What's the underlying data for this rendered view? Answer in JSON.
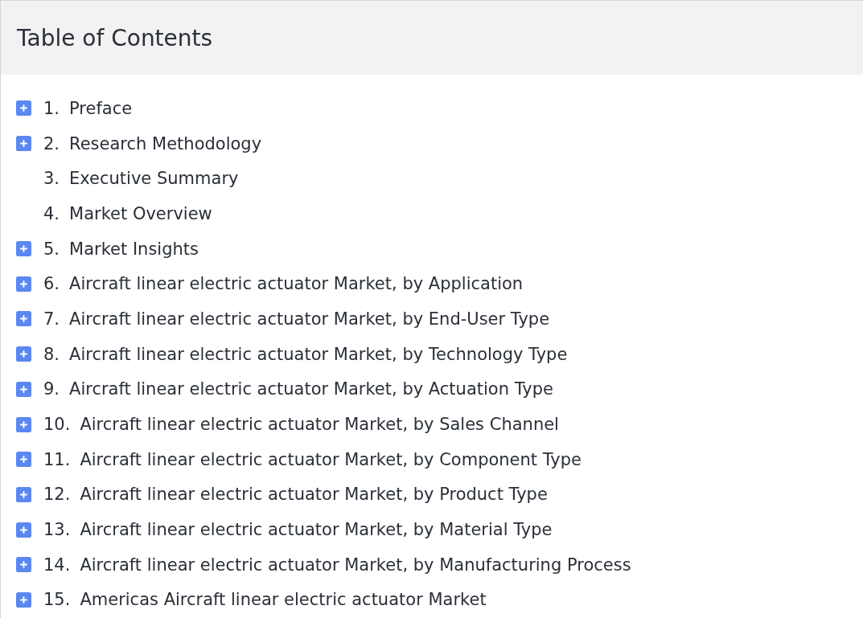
{
  "title": "Table of Contents",
  "items": [
    {
      "number": "1.",
      "label": "Preface",
      "expandable": true
    },
    {
      "number": "2.",
      "label": "Research Methodology",
      "expandable": true
    },
    {
      "number": "3.",
      "label": "Executive Summary",
      "expandable": false
    },
    {
      "number": "4.",
      "label": "Market Overview",
      "expandable": false
    },
    {
      "number": "5.",
      "label": "Market Insights",
      "expandable": true
    },
    {
      "number": "6.",
      "label": "Aircraft linear electric actuator Market, by Application",
      "expandable": true
    },
    {
      "number": "7.",
      "label": "Aircraft linear electric actuator Market, by End-User Type",
      "expandable": true
    },
    {
      "number": "8.",
      "label": "Aircraft linear electric actuator Market, by Technology Type",
      "expandable": true
    },
    {
      "number": "9.",
      "label": "Aircraft linear electric actuator Market, by Actuation Type",
      "expandable": true
    },
    {
      "number": "10.",
      "label": "Aircraft linear electric actuator Market, by Sales Channel",
      "expandable": true
    },
    {
      "number": "11.",
      "label": "Aircraft linear electric actuator Market, by Component Type",
      "expandable": true
    },
    {
      "number": "12.",
      "label": "Aircraft linear electric actuator Market, by Product Type",
      "expandable": true
    },
    {
      "number": "13.",
      "label": "Aircraft linear electric actuator Market, by Material Type",
      "expandable": true
    },
    {
      "number": "14.",
      "label": "Aircraft linear electric actuator Market, by Manufacturing Process",
      "expandable": true
    },
    {
      "number": "15.",
      "label": "Americas Aircraft linear electric actuator Market",
      "expandable": true
    }
  ]
}
